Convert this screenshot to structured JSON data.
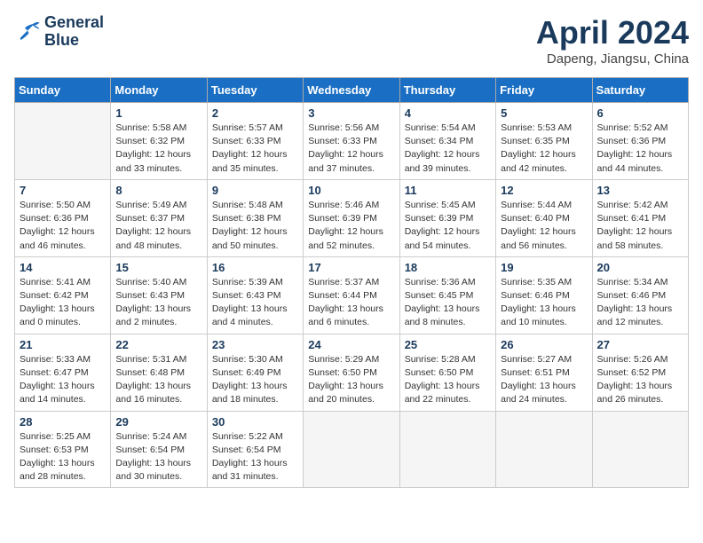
{
  "header": {
    "logo_line1": "General",
    "logo_line2": "Blue",
    "month": "April 2024",
    "location": "Dapeng, Jiangsu, China"
  },
  "weekdays": [
    "Sunday",
    "Monday",
    "Tuesday",
    "Wednesday",
    "Thursday",
    "Friday",
    "Saturday"
  ],
  "weeks": [
    [
      {
        "day": "",
        "info": ""
      },
      {
        "day": "1",
        "info": "Sunrise: 5:58 AM\nSunset: 6:32 PM\nDaylight: 12 hours\nand 33 minutes."
      },
      {
        "day": "2",
        "info": "Sunrise: 5:57 AM\nSunset: 6:33 PM\nDaylight: 12 hours\nand 35 minutes."
      },
      {
        "day": "3",
        "info": "Sunrise: 5:56 AM\nSunset: 6:33 PM\nDaylight: 12 hours\nand 37 minutes."
      },
      {
        "day": "4",
        "info": "Sunrise: 5:54 AM\nSunset: 6:34 PM\nDaylight: 12 hours\nand 39 minutes."
      },
      {
        "day": "5",
        "info": "Sunrise: 5:53 AM\nSunset: 6:35 PM\nDaylight: 12 hours\nand 42 minutes."
      },
      {
        "day": "6",
        "info": "Sunrise: 5:52 AM\nSunset: 6:36 PM\nDaylight: 12 hours\nand 44 minutes."
      }
    ],
    [
      {
        "day": "7",
        "info": "Sunrise: 5:50 AM\nSunset: 6:36 PM\nDaylight: 12 hours\nand 46 minutes."
      },
      {
        "day": "8",
        "info": "Sunrise: 5:49 AM\nSunset: 6:37 PM\nDaylight: 12 hours\nand 48 minutes."
      },
      {
        "day": "9",
        "info": "Sunrise: 5:48 AM\nSunset: 6:38 PM\nDaylight: 12 hours\nand 50 minutes."
      },
      {
        "day": "10",
        "info": "Sunrise: 5:46 AM\nSunset: 6:39 PM\nDaylight: 12 hours\nand 52 minutes."
      },
      {
        "day": "11",
        "info": "Sunrise: 5:45 AM\nSunset: 6:39 PM\nDaylight: 12 hours\nand 54 minutes."
      },
      {
        "day": "12",
        "info": "Sunrise: 5:44 AM\nSunset: 6:40 PM\nDaylight: 12 hours\nand 56 minutes."
      },
      {
        "day": "13",
        "info": "Sunrise: 5:42 AM\nSunset: 6:41 PM\nDaylight: 12 hours\nand 58 minutes."
      }
    ],
    [
      {
        "day": "14",
        "info": "Sunrise: 5:41 AM\nSunset: 6:42 PM\nDaylight: 13 hours\nand 0 minutes."
      },
      {
        "day": "15",
        "info": "Sunrise: 5:40 AM\nSunset: 6:43 PM\nDaylight: 13 hours\nand 2 minutes."
      },
      {
        "day": "16",
        "info": "Sunrise: 5:39 AM\nSunset: 6:43 PM\nDaylight: 13 hours\nand 4 minutes."
      },
      {
        "day": "17",
        "info": "Sunrise: 5:37 AM\nSunset: 6:44 PM\nDaylight: 13 hours\nand 6 minutes."
      },
      {
        "day": "18",
        "info": "Sunrise: 5:36 AM\nSunset: 6:45 PM\nDaylight: 13 hours\nand 8 minutes."
      },
      {
        "day": "19",
        "info": "Sunrise: 5:35 AM\nSunset: 6:46 PM\nDaylight: 13 hours\nand 10 minutes."
      },
      {
        "day": "20",
        "info": "Sunrise: 5:34 AM\nSunset: 6:46 PM\nDaylight: 13 hours\nand 12 minutes."
      }
    ],
    [
      {
        "day": "21",
        "info": "Sunrise: 5:33 AM\nSunset: 6:47 PM\nDaylight: 13 hours\nand 14 minutes."
      },
      {
        "day": "22",
        "info": "Sunrise: 5:31 AM\nSunset: 6:48 PM\nDaylight: 13 hours\nand 16 minutes."
      },
      {
        "day": "23",
        "info": "Sunrise: 5:30 AM\nSunset: 6:49 PM\nDaylight: 13 hours\nand 18 minutes."
      },
      {
        "day": "24",
        "info": "Sunrise: 5:29 AM\nSunset: 6:50 PM\nDaylight: 13 hours\nand 20 minutes."
      },
      {
        "day": "25",
        "info": "Sunrise: 5:28 AM\nSunset: 6:50 PM\nDaylight: 13 hours\nand 22 minutes."
      },
      {
        "day": "26",
        "info": "Sunrise: 5:27 AM\nSunset: 6:51 PM\nDaylight: 13 hours\nand 24 minutes."
      },
      {
        "day": "27",
        "info": "Sunrise: 5:26 AM\nSunset: 6:52 PM\nDaylight: 13 hours\nand 26 minutes."
      }
    ],
    [
      {
        "day": "28",
        "info": "Sunrise: 5:25 AM\nSunset: 6:53 PM\nDaylight: 13 hours\nand 28 minutes."
      },
      {
        "day": "29",
        "info": "Sunrise: 5:24 AM\nSunset: 6:54 PM\nDaylight: 13 hours\nand 30 minutes."
      },
      {
        "day": "30",
        "info": "Sunrise: 5:22 AM\nSunset: 6:54 PM\nDaylight: 13 hours\nand 31 minutes."
      },
      {
        "day": "",
        "info": ""
      },
      {
        "day": "",
        "info": ""
      },
      {
        "day": "",
        "info": ""
      },
      {
        "day": "",
        "info": ""
      }
    ]
  ]
}
